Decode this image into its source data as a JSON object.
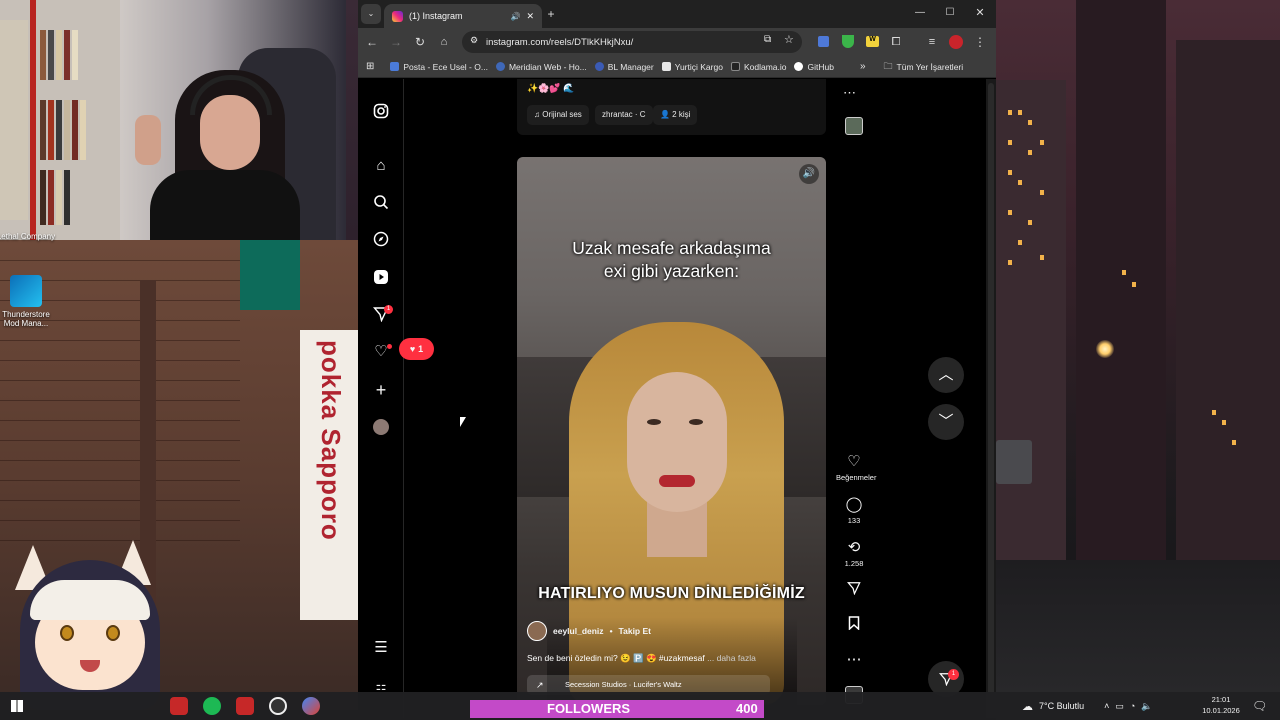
{
  "browser": {
    "tab_title": "(1) Instagram",
    "new_tab": "+",
    "url": "instagram.com/reels/DTlkKHkjNxu/",
    "window_controls": {
      "minimize": "—",
      "maximize": "☐",
      "close": "✕"
    },
    "bookmarks": [
      {
        "label": "Posta - Ece Usel - O...",
        "color": "#4b7bd8"
      },
      {
        "label": "Meridian Web - Ho...",
        "color": "#3f68b8"
      },
      {
        "label": "BL Manager",
        "color": "#3b5bb5"
      },
      {
        "label": "Yurtiçi Kargo",
        "color": "#e8e8e8"
      },
      {
        "label": "Kodlama.io",
        "color": "#222222"
      },
      {
        "label": "GitHub",
        "color": "#ffffff"
      }
    ],
    "bookmarks_overflow": "»",
    "all_bookmarks": "Tüm Yer İşaretleri"
  },
  "instagram": {
    "sidebar": {
      "badge_direct": "1",
      "notification_count": "1"
    },
    "previous_reel": {
      "emojis": "✨🌸💕 🌊",
      "chips": [
        "♫ Orijinal ses",
        "zhrantac · C",
        "👤 2 kişi"
      ]
    },
    "reel": {
      "overlay_text_1": "Uzak mesafe arkadaşıma",
      "overlay_text_2": "exi gibi yazarken:",
      "subtitle": "HATIRLIYO MUSUN DİNLEDİĞİMİZ",
      "author": "eeylul_deniz",
      "separator": "•",
      "follow": "Takip Et",
      "caption": "Sen de beni özledin mi? 😉 🅿️ 😍 #uzakmesaf",
      "caption_more": "... daha fazla",
      "music": "Secession Studios · Lucifer's Waltz",
      "music_icon": "↗"
    },
    "actions": {
      "like_label": "Beğenmeler",
      "comments": "133",
      "reposts": "1.258"
    },
    "messages_badge": "1"
  },
  "desktop": {
    "icons": [
      {
        "label": "Lethal Company"
      },
      {
        "label": "Thunderstore Mod Mana..."
      }
    ],
    "sign_text": "pokka Sapporo"
  },
  "overlay": {
    "followers_label": "FOLLOWERS",
    "followers_count": "400"
  },
  "taskbar": {
    "weather": "7°C  Bulutlu",
    "time": "21:01",
    "date": "10.01.2026"
  }
}
